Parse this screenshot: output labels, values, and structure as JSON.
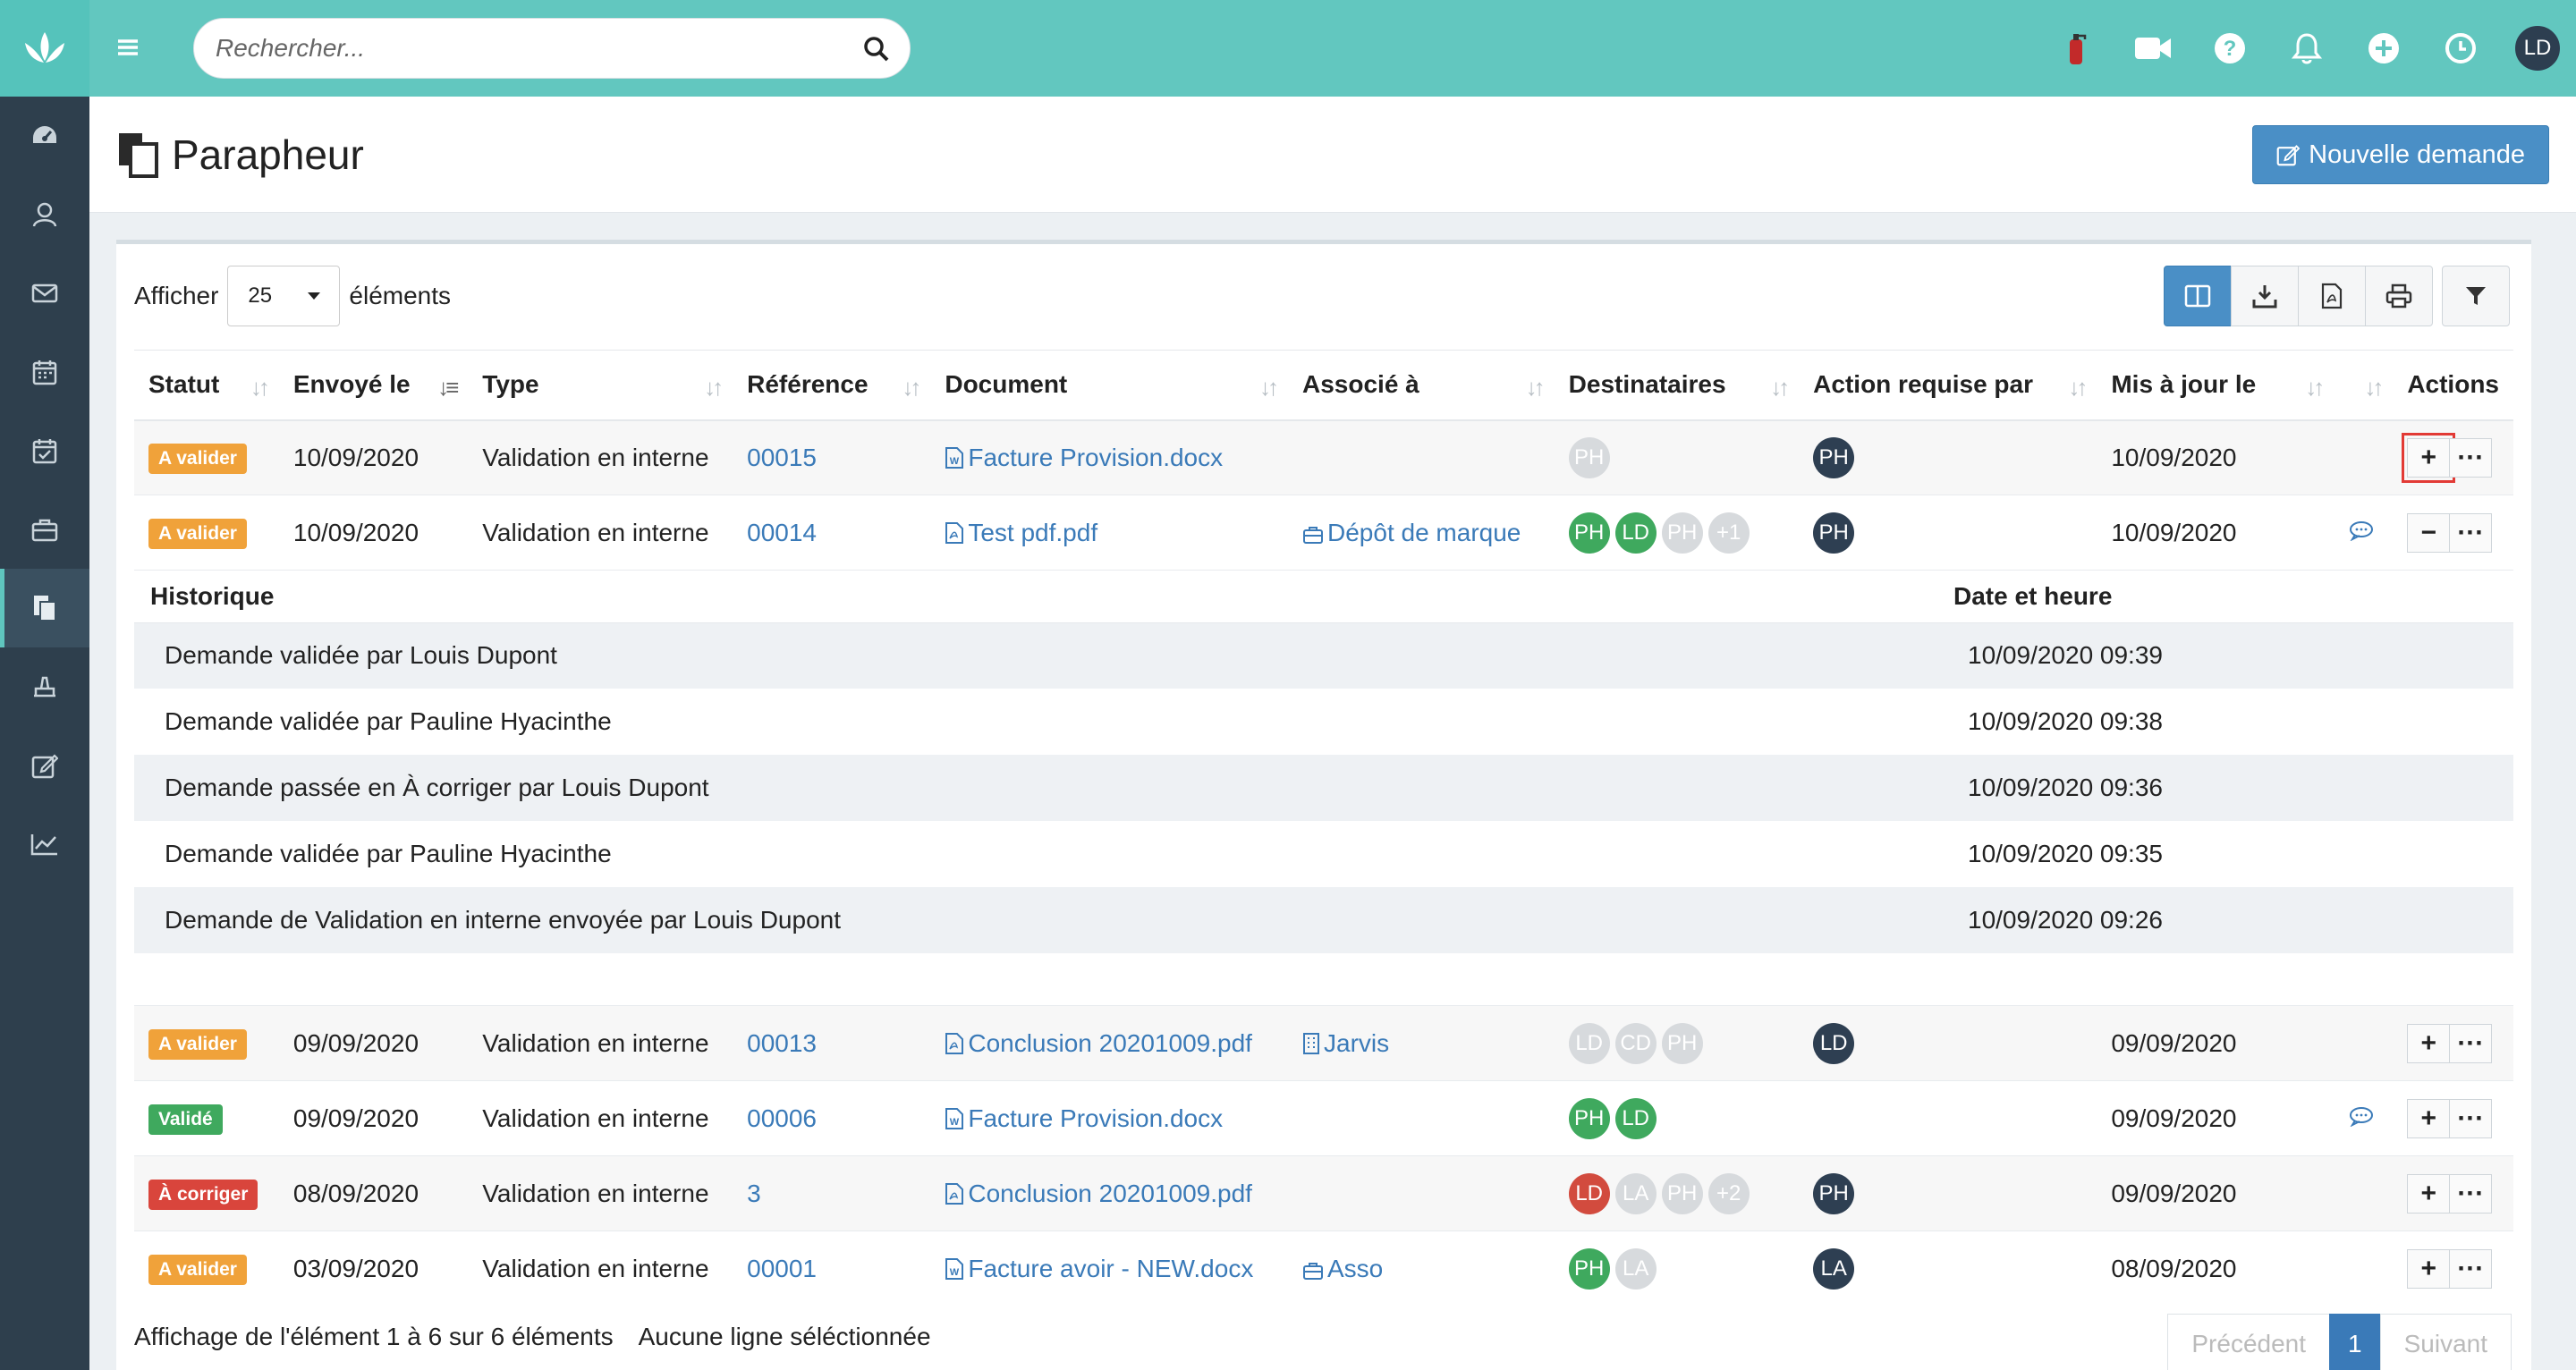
{
  "topbar": {
    "search_placeholder": "Rechercher...",
    "user_initials": "LD"
  },
  "page": {
    "title": "Parapheur",
    "new_request_label": "Nouvelle demande"
  },
  "controls": {
    "show_label": "Afficher",
    "page_size": "25",
    "elements_label": "éléments"
  },
  "columns": [
    "Statut",
    "Envoyé le",
    "Type",
    "Référence",
    "Document",
    "Associé à",
    "Destinataires",
    "Action requise par",
    "Mis à jour le",
    "",
    "Actions"
  ],
  "rows": [
    {
      "status": "A valider",
      "sent": "10/09/2020",
      "type": "Validation en interne",
      "ref": "00015",
      "doc": "Facture Provision.docx",
      "assoc": "",
      "dest": [
        "PH"
      ],
      "action_by": "PH",
      "updated": "10/09/2020",
      "expand": "+"
    },
    {
      "status": "A valider",
      "sent": "10/09/2020",
      "type": "Validation en interne",
      "ref": "00014",
      "doc": "Test pdf.pdf",
      "assoc": "Dépôt de marque",
      "dest": [
        "PH",
        "LD",
        "PH",
        "+1"
      ],
      "action_by": "PH",
      "updated": "10/09/2020",
      "expand": "−"
    },
    {
      "status": "A valider",
      "sent": "09/09/2020",
      "type": "Validation en interne",
      "ref": "00013",
      "doc": "Conclusion 20201009.pdf",
      "assoc": "Jarvis",
      "dest": [
        "LD",
        "CD",
        "PH"
      ],
      "action_by": "LD",
      "updated": "09/09/2020",
      "expand": "+"
    },
    {
      "status": "Validé",
      "sent": "09/09/2020",
      "type": "Validation en interne",
      "ref": "00006",
      "doc": "Facture Provision.docx",
      "assoc": "",
      "dest": [
        "PH",
        "LD"
      ],
      "action_by": "",
      "updated": "09/09/2020",
      "expand": "+"
    },
    {
      "status": "À corriger",
      "sent": "08/09/2020",
      "type": "Validation en interne",
      "ref": "3",
      "doc": "Conclusion 20201009.pdf",
      "assoc": "",
      "dest": [
        "LD",
        "LA",
        "PH",
        "+2"
      ],
      "action_by": "PH",
      "updated": "09/09/2020",
      "expand": "+"
    },
    {
      "status": "A valider",
      "sent": "03/09/2020",
      "type": "Validation en interne",
      "ref": "00001",
      "doc": "Facture avoir - NEW.docx",
      "assoc": "Asso",
      "dest": [
        "PH",
        "LA"
      ],
      "action_by": "LA",
      "updated": "08/09/2020",
      "expand": "+"
    }
  ],
  "history": {
    "col_event": "Historique",
    "col_date": "Date et heure",
    "entries": [
      {
        "event": "Demande validée par Louis Dupont",
        "date": "10/09/2020 09:39"
      },
      {
        "event": "Demande validée par Pauline Hyacinthe",
        "date": "10/09/2020 09:38"
      },
      {
        "event": "Demande passée en À corriger par Louis Dupont",
        "date": "10/09/2020 09:36"
      },
      {
        "event": "Demande validée par Pauline Hyacinthe",
        "date": "10/09/2020 09:35"
      },
      {
        "event": "Demande de Validation en interne envoyée par Louis Dupont",
        "date": "10/09/2020 09:26"
      }
    ]
  },
  "footer": {
    "info": "Affichage de l'élément 1 à 6 sur 6 éléments",
    "selection": "Aucune ligne séléctionnée",
    "prev": "Précédent",
    "page": "1",
    "next": "Suivant"
  },
  "icons": [
    "lotus-logo-icon",
    "menu-icon",
    "search-icon",
    "fire-extinguisher-icon",
    "video-icon",
    "help-icon",
    "bell-icon",
    "plus-circle-icon",
    "clock-icon",
    "dashboard-icon",
    "contacts-icon",
    "mail-icon",
    "calendar-icon",
    "calendar-check-icon",
    "briefcase-icon",
    "parapheur-icon",
    "stamp-icon",
    "edit-icon",
    "chart-icon"
  ],
  "colors": {
    "accent": "#62c7bf",
    "sidebar": "#2e3f4d",
    "primary": "#4a8fc6",
    "warning": "#f0a23a",
    "success": "#3fa95e",
    "danger": "#d9453c"
  }
}
